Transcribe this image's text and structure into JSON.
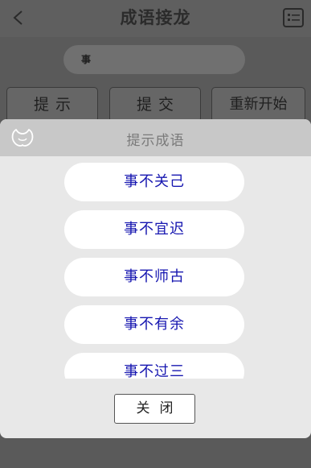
{
  "app": {
    "title": "成语接龙",
    "back_glyph": "<",
    "current_word": "事",
    "buttons": {
      "hint": "提示",
      "submit": "提交",
      "restart": "重新开始"
    }
  },
  "dialog": {
    "title": "提示成语",
    "options": [
      "事不关己",
      "事不宜迟",
      "事不师古",
      "事不有余",
      "事不过三"
    ],
    "close_label": "关闭"
  }
}
